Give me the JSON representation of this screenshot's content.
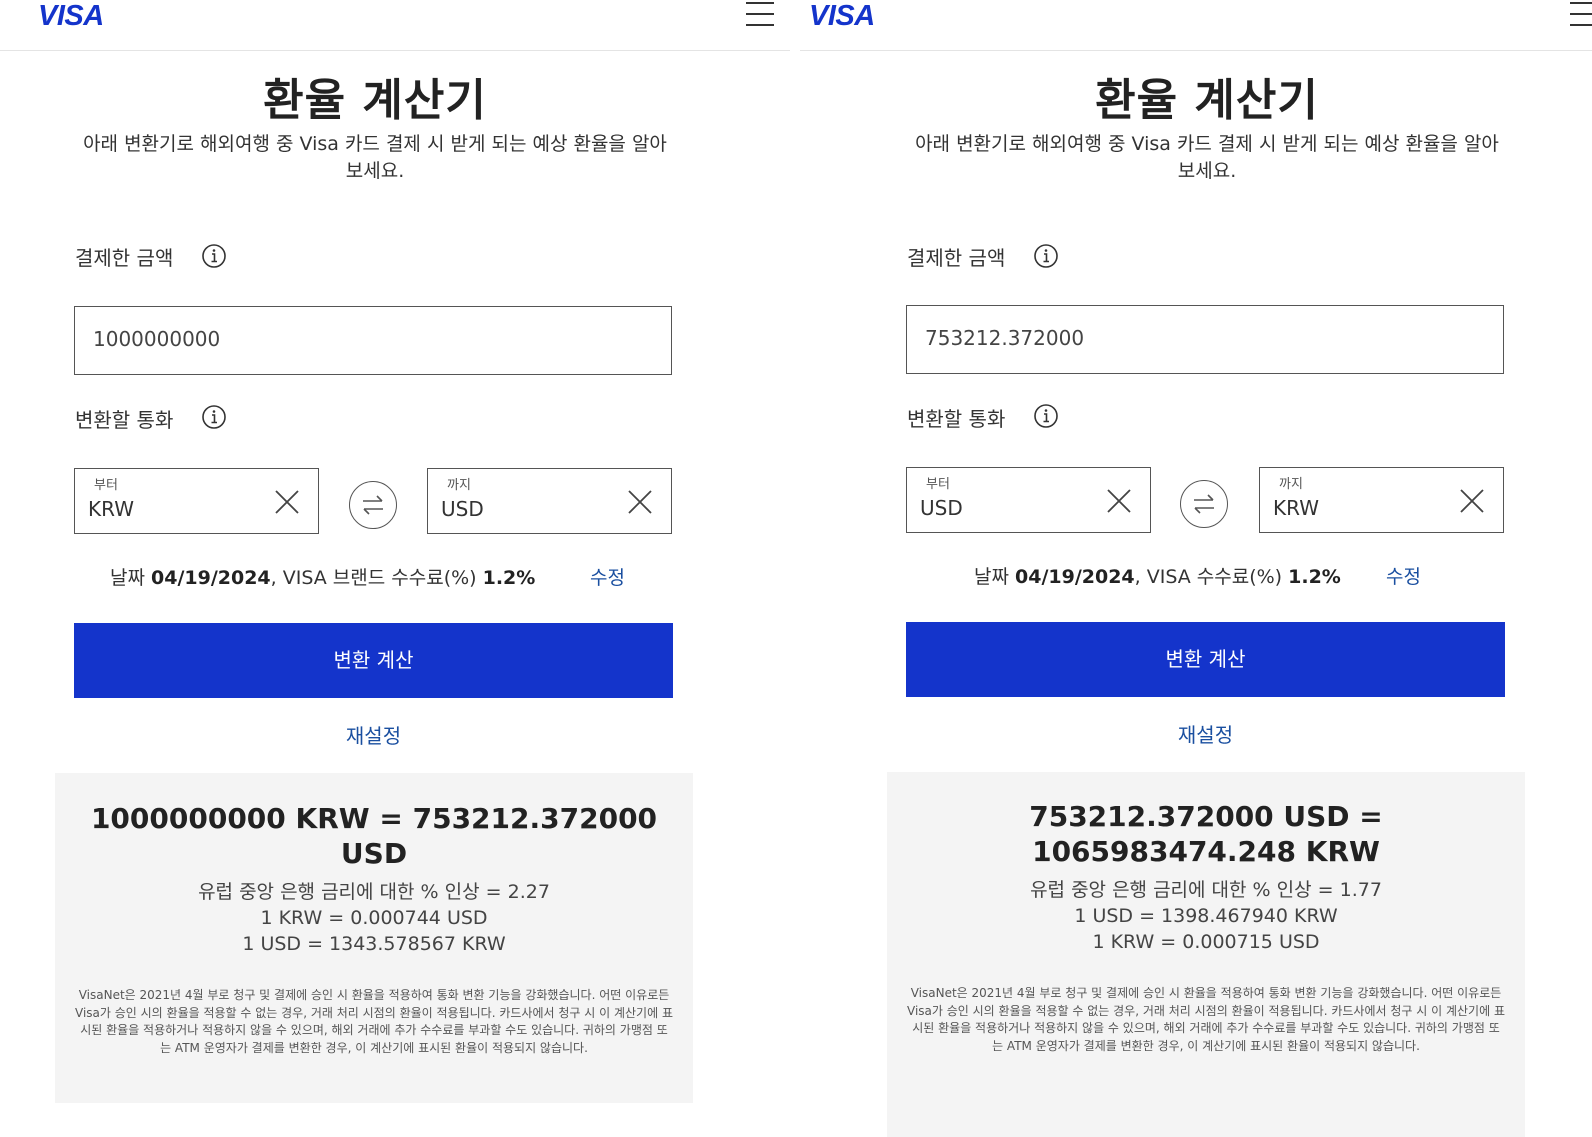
{
  "left": {
    "header": {
      "logo": "VISA"
    },
    "title": "환율 계산기",
    "subtitle": "아래 변환기로 해외여행 중 Visa 카드 결제 시 받게 되는 예상 환율을 알아보세요.",
    "amount_label": "결제한 금액",
    "amount_value": "1000000000",
    "currency_label": "변환할 통화",
    "from": {
      "label": "부터",
      "value": "KRW"
    },
    "to": {
      "label": "까지",
      "value": "USD"
    },
    "fee": {
      "date_prefix": "날짜 ",
      "date": "04/19/2024",
      "fee_text": ", VISA 브랜드 수수료(%) ",
      "fee_value": "1.2%",
      "edit": "수정"
    },
    "convert_button": "변환 계산",
    "reset_link": "재설정",
    "result": {
      "main": "1000000000 KRW = 753212.372000 USD",
      "lines": [
        "유럽 중앙 은행 금리에 대한 % 인상 = 2.27",
        "1 KRW = 0.000744 USD",
        "1 USD = 1343.578567 KRW"
      ],
      "disclaimer": "VisaNet은 2021년 4월 부로 청구 및 결제에 승인 시 환율을 적용하여 통화 변환 기능을 강화했습니다. 어떤 이유로든 Visa가 승인 시의 환율을 적용할 수 없는 경우, 거래 처리 시점의 환율이 적용됩니다. 카드사에서 청구 시 이 계산기에 표시된 환율을 적용하거나 적용하지 않을 수 있으며, 해외 거래에 추가 수수료를 부과할 수도 있습니다. 귀하의 가맹점 또는 ATM 운영자가 결제를 변환한 경우, 이 계산기에 표시된 환율이 적용되지 않습니다."
    }
  },
  "right": {
    "header": {
      "logo": "VISA"
    },
    "title": "환율 계산기",
    "subtitle": "아래 변환기로 해외여행 중 Visa 카드 결제 시 받게 되는 예상 환율을 알아보세요.",
    "amount_label": "결제한 금액",
    "amount_value": "753212.372000",
    "currency_label": "변환할 통화",
    "from": {
      "label": "부터",
      "value": "USD"
    },
    "to": {
      "label": "까지",
      "value": "KRW"
    },
    "fee": {
      "date_prefix": "날짜 ",
      "date": "04/19/2024",
      "fee_text": ", VISA 수수료(%) ",
      "fee_value": "1.2%",
      "edit": "수정"
    },
    "convert_button": "변환 계산",
    "reset_link": "재설정",
    "result": {
      "main": "753212.372000 USD = 1065983474.248 KRW",
      "lines": [
        "유럽 중앙 은행 금리에 대한 % 인상 = 1.77",
        "1 USD = 1398.467940 KRW",
        "1 KRW = 0.000715 USD"
      ],
      "disclaimer": "VisaNet은 2021년 4월 부로 청구 및 결제에 승인 시 환율을 적용하여 통화 변환 기능을 강화했습니다. 어떤 이유로든 Visa가 승인 시의 환율을 적용할 수 없는 경우, 거래 처리 시점의 환율이 적용됩니다. 카드사에서 청구 시 이 계산기에 표시된 환율을 적용하거나 적용하지 않을 수 있으며, 해외 거래에 추가 수수료를 부과할 수도 있습니다. 귀하의 가맹점 또는 ATM 운영자가 결제를 변환한 경우, 이 계산기에 표시된 환율이 적용되지 않습니다."
    }
  },
  "colors": {
    "brand": "#1434cb",
    "link": "#1a4fa0",
    "result_bg": "#f4f4f4"
  }
}
